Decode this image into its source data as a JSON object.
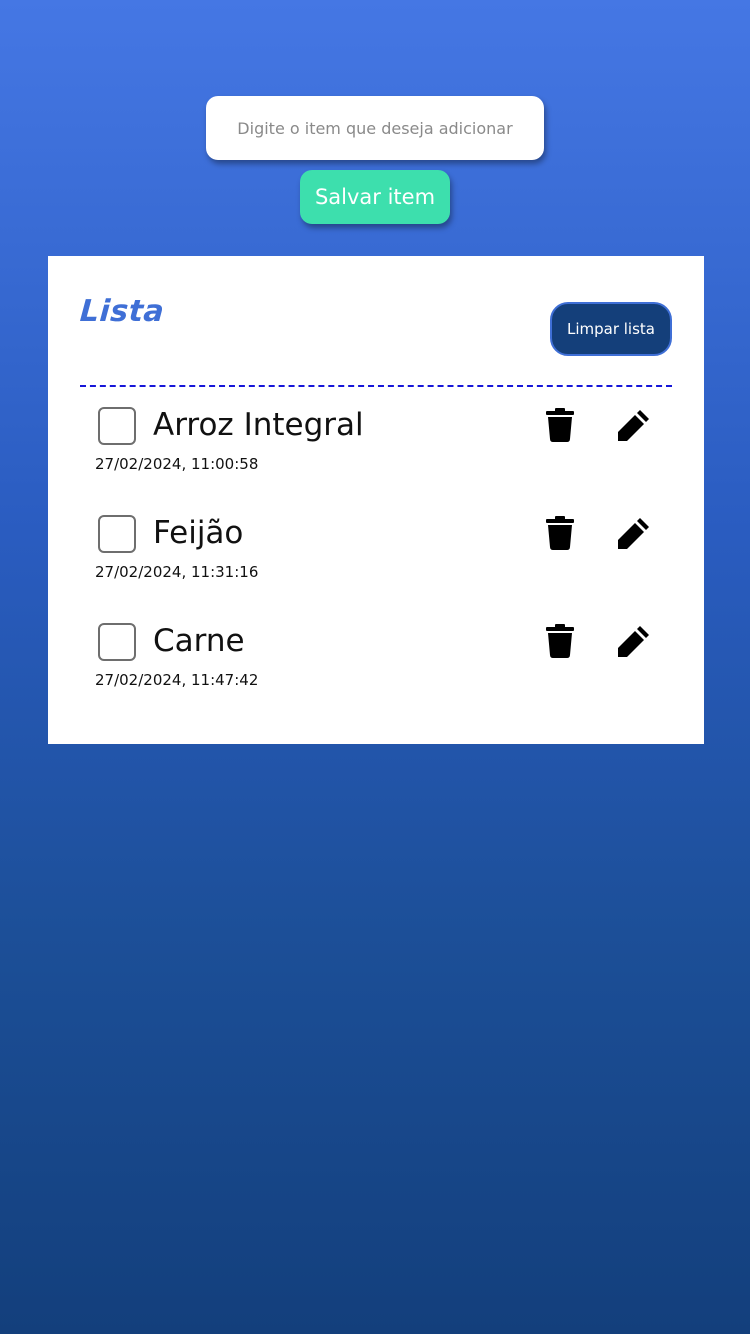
{
  "form": {
    "input_placeholder": "Digite o item que deseja adicionar",
    "input_value": "",
    "save_label": "Salvar item"
  },
  "list": {
    "title": "Lista",
    "clear_label": "Limpar lista",
    "items": [
      {
        "name": "Arroz Integral",
        "timestamp": "27/02/2024, 11:00:58",
        "checked": false
      },
      {
        "name": "Feijão",
        "timestamp": "27/02/2024, 11:31:16",
        "checked": false
      },
      {
        "name": "Carne",
        "timestamp": "27/02/2024, 11:47:42",
        "checked": false
      }
    ],
    "item_icons": {
      "delete": "trash-icon",
      "edit": "pencil-icon"
    }
  },
  "colors": {
    "accent_green": "#3ddfad",
    "title_blue": "#3f6fd6",
    "clear_button_bg": "#143f7a",
    "divider_blue": "#1616d8",
    "background_top": "#4577e4",
    "background_bottom": "#133f7c"
  }
}
